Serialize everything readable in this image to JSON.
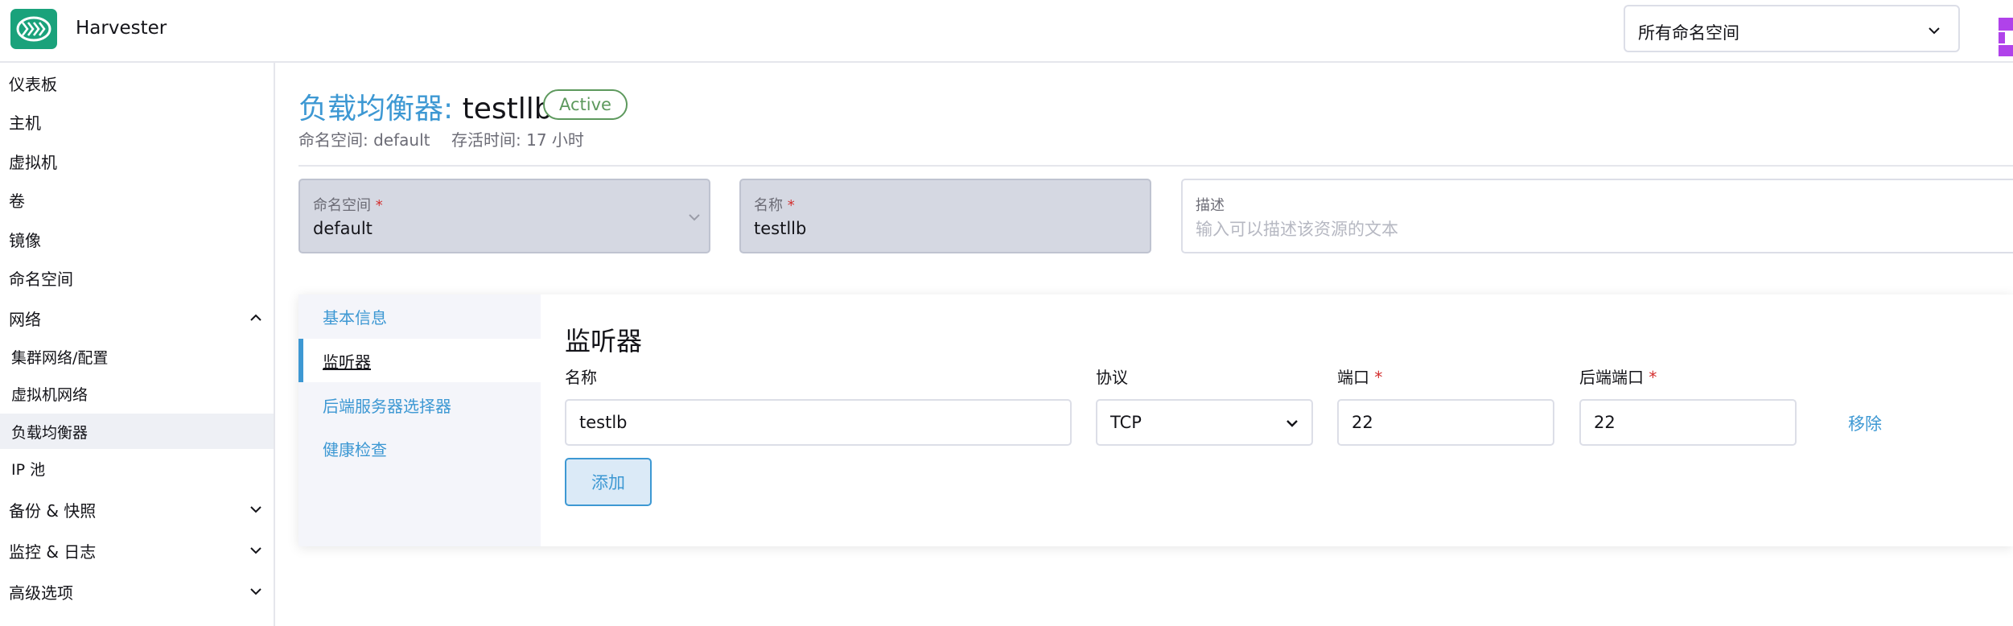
{
  "header": {
    "app_title": "Harvester",
    "logo_icon": "harvester-logo-icon",
    "namespace_filter": "所有命名空间"
  },
  "colors": {
    "brand": "#1aa27b",
    "link": "#3d98d3",
    "active_badge": "#5d995d",
    "required": "#d32f2f"
  },
  "sidebar": {
    "items": [
      {
        "label": "仪表板"
      },
      {
        "label": "主机"
      },
      {
        "label": "虚拟机"
      },
      {
        "label": "卷"
      },
      {
        "label": "镜像"
      },
      {
        "label": "命名空间"
      },
      {
        "label": "网络",
        "expanded": true
      },
      {
        "label": "集群网络/配置"
      },
      {
        "label": "虚拟机网络"
      },
      {
        "label": "负载均衡器",
        "active": true
      },
      {
        "label": "IP 池"
      },
      {
        "label": "备份 & 快照",
        "expanded": false
      },
      {
        "label": "监控 & 日志",
        "expanded": false
      },
      {
        "label": "高级选项",
        "expanded": false
      }
    ]
  },
  "page": {
    "resource_type": "负载均衡器:",
    "resource_name": "testllb",
    "status": "Active",
    "namespace_meta": "命名空间: default",
    "age_meta": "存活时间: 17 小时"
  },
  "form": {
    "namespace": {
      "label": "命名空间",
      "required_mark": "*",
      "value": "default"
    },
    "name": {
      "label": "名称",
      "required_mark": "*",
      "value": "testllb"
    },
    "description": {
      "label": "描述",
      "placeholder": "输入可以描述该资源的文本"
    }
  },
  "tabs": {
    "items": [
      {
        "label": "基本信息"
      },
      {
        "label": "监听器",
        "active": true
      },
      {
        "label": "后端服务器选择器"
      },
      {
        "label": "健康检查"
      }
    ]
  },
  "listeners": {
    "title": "监听器",
    "columns": {
      "name": "名称",
      "protocol": "协议",
      "port": "端口",
      "backend_port": "后端端口",
      "required_mark": "*"
    },
    "rows": [
      {
        "name": "testlb",
        "protocol": "TCP",
        "port": "22",
        "backend_port": "22",
        "remove_label": "移除"
      }
    ],
    "add_label": "添加"
  }
}
